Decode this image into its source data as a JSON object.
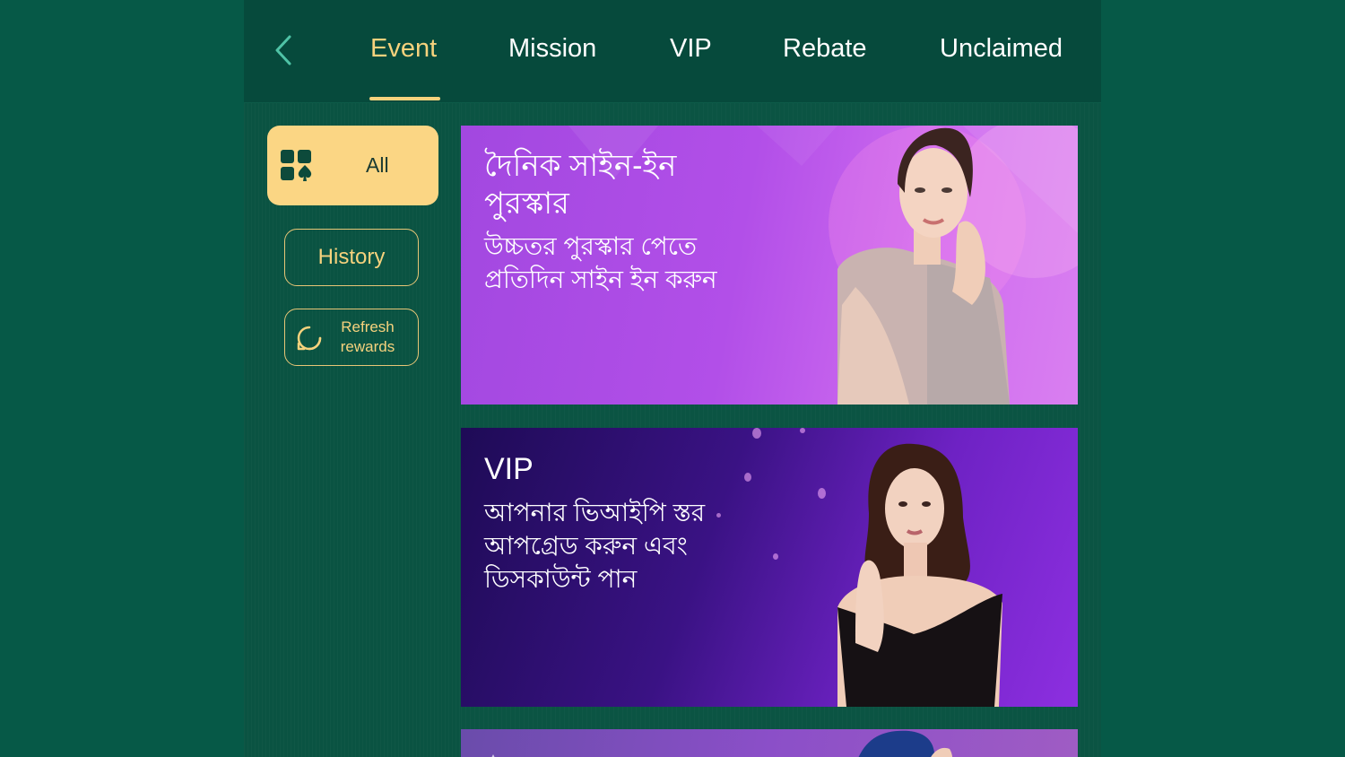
{
  "nav": {
    "back_icon": "chevron-left-icon",
    "tabs": [
      {
        "label": "Event",
        "active": true
      },
      {
        "label": "Mission",
        "active": false
      },
      {
        "label": "VIP",
        "active": false
      },
      {
        "label": "Rebate",
        "active": false
      },
      {
        "label": "Unclaimed",
        "active": false
      }
    ]
  },
  "sidebar": {
    "all": {
      "label": "All",
      "icon": "category-grid-icon"
    },
    "history": {
      "label": "History"
    },
    "refresh": {
      "label": "Refresh rewards",
      "line1": "Refresh",
      "line2": "rewards",
      "icon": "refresh-icon"
    }
  },
  "banners": [
    {
      "title": "দৈনিক সাইন-ইন পুরস্কার",
      "subtitle": "উচ্চতর পুরস্কার পেতে প্রতিদিন সাইন ইন করুন"
    },
    {
      "title": "VIP",
      "subtitle": "আপনার ভিআইপি স্তর আপগ্রেড করুন এবং ডিসকাউন্ট পান"
    }
  ],
  "colors": {
    "accent": "#f6d27d",
    "page_bg": "#065947",
    "header_bg": "#064a3c",
    "banner_1": "#b24fe8",
    "banner_2": "#3a1284"
  }
}
